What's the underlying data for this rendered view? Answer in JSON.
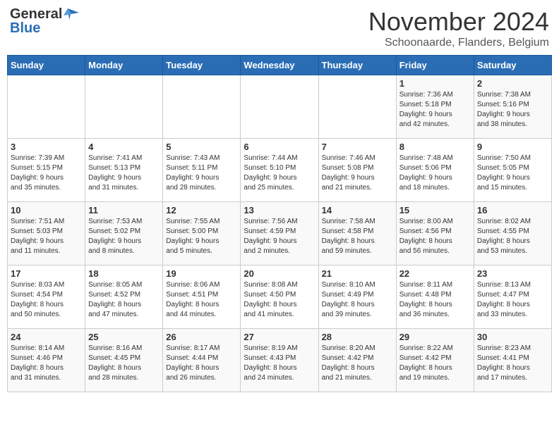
{
  "logo": {
    "general": "General",
    "blue": "Blue"
  },
  "title": "November 2024",
  "location": "Schoonaarde, Flanders, Belgium",
  "days_of_week": [
    "Sunday",
    "Monday",
    "Tuesday",
    "Wednesday",
    "Thursday",
    "Friday",
    "Saturday"
  ],
  "weeks": [
    [
      {
        "day": "",
        "info": ""
      },
      {
        "day": "",
        "info": ""
      },
      {
        "day": "",
        "info": ""
      },
      {
        "day": "",
        "info": ""
      },
      {
        "day": "",
        "info": ""
      },
      {
        "day": "1",
        "info": "Sunrise: 7:36 AM\nSunset: 5:18 PM\nDaylight: 9 hours\nand 42 minutes."
      },
      {
        "day": "2",
        "info": "Sunrise: 7:38 AM\nSunset: 5:16 PM\nDaylight: 9 hours\nand 38 minutes."
      }
    ],
    [
      {
        "day": "3",
        "info": "Sunrise: 7:39 AM\nSunset: 5:15 PM\nDaylight: 9 hours\nand 35 minutes."
      },
      {
        "day": "4",
        "info": "Sunrise: 7:41 AM\nSunset: 5:13 PM\nDaylight: 9 hours\nand 31 minutes."
      },
      {
        "day": "5",
        "info": "Sunrise: 7:43 AM\nSunset: 5:11 PM\nDaylight: 9 hours\nand 28 minutes."
      },
      {
        "day": "6",
        "info": "Sunrise: 7:44 AM\nSunset: 5:10 PM\nDaylight: 9 hours\nand 25 minutes."
      },
      {
        "day": "7",
        "info": "Sunrise: 7:46 AM\nSunset: 5:08 PM\nDaylight: 9 hours\nand 21 minutes."
      },
      {
        "day": "8",
        "info": "Sunrise: 7:48 AM\nSunset: 5:06 PM\nDaylight: 9 hours\nand 18 minutes."
      },
      {
        "day": "9",
        "info": "Sunrise: 7:50 AM\nSunset: 5:05 PM\nDaylight: 9 hours\nand 15 minutes."
      }
    ],
    [
      {
        "day": "10",
        "info": "Sunrise: 7:51 AM\nSunset: 5:03 PM\nDaylight: 9 hours\nand 11 minutes."
      },
      {
        "day": "11",
        "info": "Sunrise: 7:53 AM\nSunset: 5:02 PM\nDaylight: 9 hours\nand 8 minutes."
      },
      {
        "day": "12",
        "info": "Sunrise: 7:55 AM\nSunset: 5:00 PM\nDaylight: 9 hours\nand 5 minutes."
      },
      {
        "day": "13",
        "info": "Sunrise: 7:56 AM\nSunset: 4:59 PM\nDaylight: 9 hours\nand 2 minutes."
      },
      {
        "day": "14",
        "info": "Sunrise: 7:58 AM\nSunset: 4:58 PM\nDaylight: 8 hours\nand 59 minutes."
      },
      {
        "day": "15",
        "info": "Sunrise: 8:00 AM\nSunset: 4:56 PM\nDaylight: 8 hours\nand 56 minutes."
      },
      {
        "day": "16",
        "info": "Sunrise: 8:02 AM\nSunset: 4:55 PM\nDaylight: 8 hours\nand 53 minutes."
      }
    ],
    [
      {
        "day": "17",
        "info": "Sunrise: 8:03 AM\nSunset: 4:54 PM\nDaylight: 8 hours\nand 50 minutes."
      },
      {
        "day": "18",
        "info": "Sunrise: 8:05 AM\nSunset: 4:52 PM\nDaylight: 8 hours\nand 47 minutes."
      },
      {
        "day": "19",
        "info": "Sunrise: 8:06 AM\nSunset: 4:51 PM\nDaylight: 8 hours\nand 44 minutes."
      },
      {
        "day": "20",
        "info": "Sunrise: 8:08 AM\nSunset: 4:50 PM\nDaylight: 8 hours\nand 41 minutes."
      },
      {
        "day": "21",
        "info": "Sunrise: 8:10 AM\nSunset: 4:49 PM\nDaylight: 8 hours\nand 39 minutes."
      },
      {
        "day": "22",
        "info": "Sunrise: 8:11 AM\nSunset: 4:48 PM\nDaylight: 8 hours\nand 36 minutes."
      },
      {
        "day": "23",
        "info": "Sunrise: 8:13 AM\nSunset: 4:47 PM\nDaylight: 8 hours\nand 33 minutes."
      }
    ],
    [
      {
        "day": "24",
        "info": "Sunrise: 8:14 AM\nSunset: 4:46 PM\nDaylight: 8 hours\nand 31 minutes."
      },
      {
        "day": "25",
        "info": "Sunrise: 8:16 AM\nSunset: 4:45 PM\nDaylight: 8 hours\nand 28 minutes."
      },
      {
        "day": "26",
        "info": "Sunrise: 8:17 AM\nSunset: 4:44 PM\nDaylight: 8 hours\nand 26 minutes."
      },
      {
        "day": "27",
        "info": "Sunrise: 8:19 AM\nSunset: 4:43 PM\nDaylight: 8 hours\nand 24 minutes."
      },
      {
        "day": "28",
        "info": "Sunrise: 8:20 AM\nSunset: 4:42 PM\nDaylight: 8 hours\nand 21 minutes."
      },
      {
        "day": "29",
        "info": "Sunrise: 8:22 AM\nSunset: 4:42 PM\nDaylight: 8 hours\nand 19 minutes."
      },
      {
        "day": "30",
        "info": "Sunrise: 8:23 AM\nSunset: 4:41 PM\nDaylight: 8 hours\nand 17 minutes."
      }
    ]
  ]
}
